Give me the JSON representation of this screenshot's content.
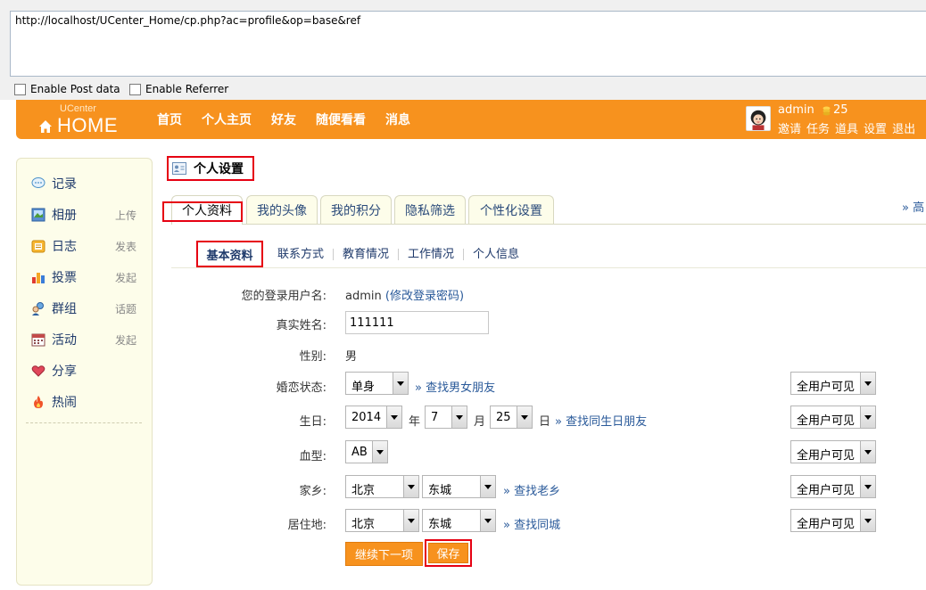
{
  "url_bar": {
    "url": "http://localhost/UCenter_Home/cp.php?ac=profile&op=base&ref",
    "enable_post": "Enable Post data",
    "enable_referrer": "Enable Referrer"
  },
  "header": {
    "logo_small": "UCenter",
    "logo_main": "HOME",
    "nav": [
      "首页",
      "个人主页",
      "好友",
      "随便看看",
      "消息"
    ],
    "username": "admin",
    "credit": "25",
    "user_links": [
      "邀请",
      "任务",
      "道具",
      "设置",
      "退出"
    ]
  },
  "sidebar": {
    "items": [
      {
        "label": "记录",
        "action": "",
        "icon": "speech-bubble-icon"
      },
      {
        "label": "相册",
        "action": "上传",
        "icon": "photo-album-icon"
      },
      {
        "label": "日志",
        "action": "发表",
        "icon": "blog-icon"
      },
      {
        "label": "投票",
        "action": "发起",
        "icon": "poll-chart-icon"
      },
      {
        "label": "群组",
        "action": "话题",
        "icon": "group-icon"
      },
      {
        "label": "活动",
        "action": "发起",
        "icon": "calendar-icon"
      },
      {
        "label": "分享",
        "action": "",
        "icon": "share-heart-icon"
      },
      {
        "label": "热闹",
        "action": "",
        "icon": "fire-icon"
      }
    ]
  },
  "main": {
    "title": "个人设置",
    "tabs": [
      "个人资料",
      "我的头像",
      "我的积分",
      "隐私筛选",
      "个性化设置"
    ],
    "more": "» 高",
    "subnav": [
      "基本资料",
      "联系方式",
      "教育情况",
      "工作情况",
      "个人信息"
    ]
  },
  "form": {
    "login_name_label": "您的登录用户名:",
    "login_name_value": "admin",
    "change_password": "(修改登录密码)",
    "realname_label": "真实姓名:",
    "realname_value": "111111",
    "gender_label": "性别:",
    "gender_value": "男",
    "marriage_label": "婚恋状态:",
    "marriage_value": "单身",
    "marriage_link": "» 查找男女朋友",
    "birthday_label": "生日:",
    "birth_year": "2014",
    "year_unit": "年",
    "birth_month": "7",
    "month_unit": "月",
    "birth_day": "25",
    "day_unit": "日",
    "birthday_link": "» 查找同生日朋友",
    "blood_label": "血型:",
    "blood_value": "AB",
    "hometown_label": "家乡:",
    "hometown_province": "北京",
    "hometown_city": "东城",
    "hometown_link": "» 查找老乡",
    "residence_label": "居住地:",
    "residence_province": "北京",
    "residence_city": "东城",
    "residence_link": "» 查找同城",
    "privacy": "全用户可见",
    "next_button": "继续下一项",
    "save_button": "保存"
  }
}
